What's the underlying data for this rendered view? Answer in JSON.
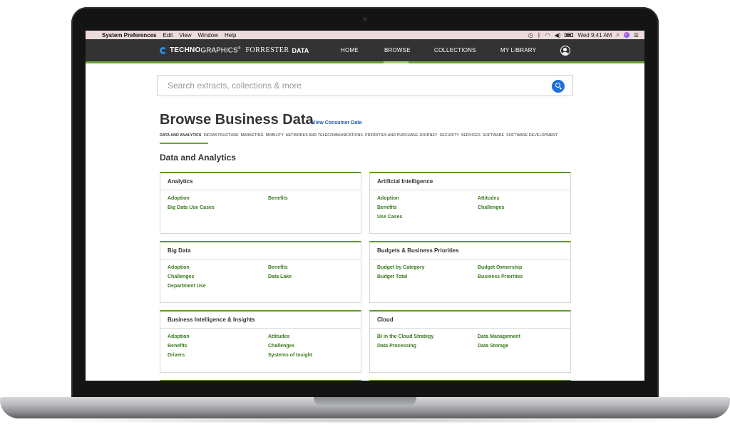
{
  "menubar": {
    "app_name": "System Preferences",
    "menus": [
      "Edit",
      "View",
      "Window",
      "Help"
    ],
    "clock": "Wed 9:41 AM"
  },
  "header": {
    "logo": {
      "techno": "TECHNO",
      "graphics": "GRAPHICS",
      "trademark": "®",
      "forrester": "FORRESTER",
      "data": "DATA"
    },
    "nav": [
      "HOME",
      "BROWSE",
      "COLLECTIONS",
      "MY LIBRARY"
    ],
    "active_nav": "BROWSE",
    "accent_color": "#6aa43a"
  },
  "search": {
    "placeholder": "Search extracts, collections & more"
  },
  "page": {
    "title": "Browse Business Data",
    "consumer_link": "View Consumer Data",
    "categories": [
      "DATA AND ANALYTICS",
      "INFRASTRUCTURE",
      "MARKETING",
      "MOBILITY",
      "NETWORKS AND TELECOMMUNICATIONS",
      "PRIORITIES AND PURCHASE JOURNEY",
      "SECURITY",
      "SERVICES",
      "SOFTWARE",
      "SOFTWARE DEVELOPMENT"
    ],
    "active_category": "DATA AND ANALYTICS",
    "section_title": "Data and Analytics"
  },
  "cards": [
    {
      "title": "Analytics",
      "links": [
        "Adoption",
        "Benefits",
        "Big Data Use Cases"
      ]
    },
    {
      "title": "Artificial Intelligence",
      "links": [
        "Adoption",
        "Attitudes",
        "Benefits",
        "Challenges",
        "Use Cases"
      ]
    },
    {
      "title": "Big Data",
      "links": [
        "Adoption",
        "Benefits",
        "Challenges",
        "Data Lake",
        "Department Use"
      ]
    },
    {
      "title": "Budgets & Business Priorities",
      "links": [
        "Budget by Category",
        "Budget Ownership",
        "Budget Total",
        "Business Priorities"
      ]
    },
    {
      "title": "Business Intelligence & Insights",
      "links": [
        "Adoption",
        "Attitudes",
        "Benefits",
        "Challenges",
        "Drivers",
        "Systems of Insight"
      ]
    },
    {
      "title": "Cloud",
      "links": [
        "BI in the Cloud Strategy",
        "Data Management",
        "Data Processing",
        "Data Storage"
      ]
    }
  ],
  "colors": {
    "link_green": "#3a7a1e",
    "card_border_green": "#5d9a2c",
    "search_button_blue": "#1e6fd9"
  }
}
